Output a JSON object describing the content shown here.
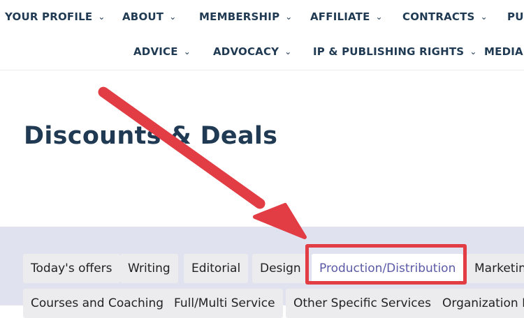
{
  "nav": {
    "row1": [
      {
        "label": "YOUR PROFILE",
        "chevron": "chevron-down-icon"
      },
      {
        "label": "ABOUT",
        "chevron": "chevron-down-icon"
      },
      {
        "label": "MEMBERSHIP",
        "chevron": "chevron-down-icon"
      },
      {
        "label": "AFFILIATE",
        "chevron": "chevron-down-icon"
      },
      {
        "label": "CONTRACTS",
        "chevron": "chevron-down-icon"
      },
      {
        "label": "PU"
      }
    ],
    "row2": [
      {
        "label": "ADVICE",
        "chevron": "chevron-down-icon"
      },
      {
        "label": "ADVOCACY",
        "chevron": "chevron-down-icon"
      },
      {
        "label": "IP & PUBLISHING RIGHTS",
        "chevron": "chevron-down-icon"
      },
      {
        "label": "MEDIA"
      }
    ],
    "chevron_glyph": "⌄"
  },
  "page": {
    "title": "Discounts & Deals"
  },
  "filters": {
    "row1": [
      {
        "label": "Today's offers"
      },
      {
        "label": "Writing"
      },
      {
        "label": "Editorial"
      },
      {
        "label": "Design"
      },
      {
        "label": "Production/Distribution",
        "selected": true
      },
      {
        "label": "Marketin"
      }
    ],
    "row2": [
      {
        "label": "Courses and Coaching"
      },
      {
        "label": "Full/Multi Service"
      },
      {
        "label": "Other Specific Services"
      },
      {
        "label": "Organization D"
      }
    ]
  },
  "colors": {
    "nav_text": "#1f3a52",
    "filter_band": "#e1e2ef",
    "chip_bg": "#ececee",
    "chip_active_text": "#5b5aa6",
    "annotation_red": "#e23d45"
  }
}
